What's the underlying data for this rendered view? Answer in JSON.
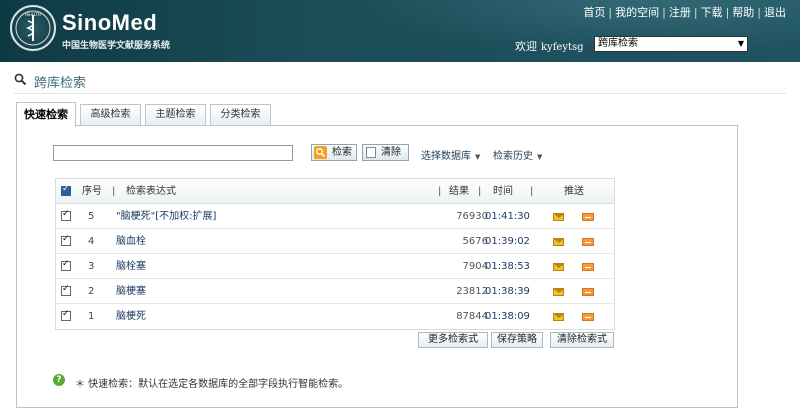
{
  "header": {
    "brand": "SinoMed",
    "subtitle": "中国生物医学文献服务系统",
    "links": [
      "首页",
      "我的空间",
      "注册",
      "下载",
      "帮助",
      "退出"
    ],
    "welcome_label": "欢迎",
    "username": "kyfeytsg",
    "db_select_value": "跨库检索",
    "seal_text": "HEALTH"
  },
  "page": {
    "title": "跨库检索"
  },
  "tabs": [
    {
      "label": "快速检索",
      "active": true
    },
    {
      "label": "高级检索",
      "active": false
    },
    {
      "label": "主题检索",
      "active": false
    },
    {
      "label": "分类检索",
      "active": false
    }
  ],
  "search": {
    "query_value": "",
    "search_label": "检索",
    "clear_label": "清除",
    "select_db_label": "选择数据库",
    "history_label": "检索历史"
  },
  "history": {
    "columns": {
      "seq": "序号",
      "expr": "检索表达式",
      "results": "结果",
      "time": "时间",
      "push": "推送"
    },
    "rows": [
      {
        "seq": "5",
        "expr": "\"脑梗死\"[不加权:扩展]",
        "results": "76930",
        "time": "01:41:30"
      },
      {
        "seq": "4",
        "expr": "脑血栓",
        "results": "5676",
        "time": "01:39:02"
      },
      {
        "seq": "3",
        "expr": "脑栓塞",
        "results": "7904",
        "time": "01:38:53"
      },
      {
        "seq": "2",
        "expr": "脑梗塞",
        "results": "23812",
        "time": "01:38:39"
      },
      {
        "seq": "1",
        "expr": "脑梗死",
        "results": "87844",
        "time": "01:38:09"
      }
    ],
    "buttons": {
      "more": "更多检索式",
      "save": "保存策略",
      "clear": "清除检索式"
    }
  },
  "tip": {
    "icon_glyph": "?",
    "text": "＊ 快速检索：默认在选定各数据库的全部字段执行智能检索。"
  }
}
